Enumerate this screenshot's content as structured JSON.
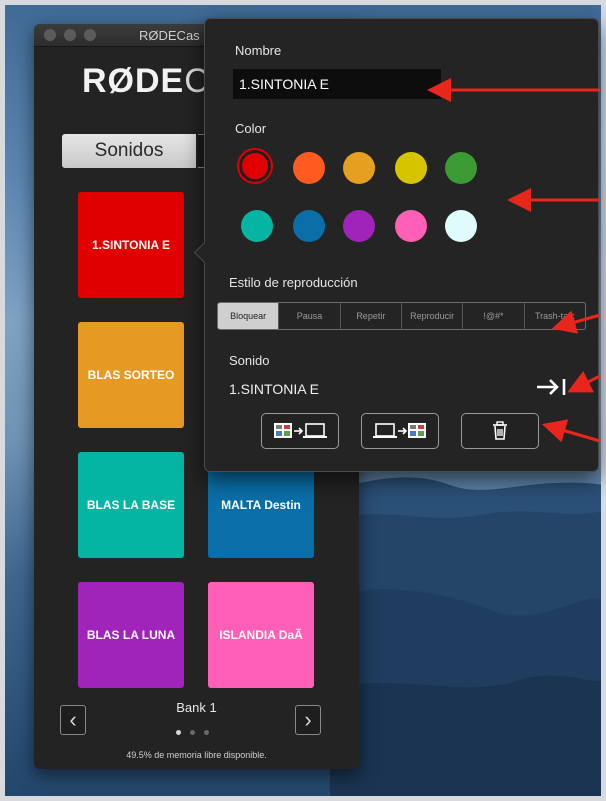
{
  "window": {
    "title": "RØDECas",
    "logo_bold": "RØDE",
    "logo_thin": "C"
  },
  "tabs": {
    "active": "Sonidos"
  },
  "pads": [
    {
      "label": "1.SINTONIA E",
      "color": "#e00000"
    },
    {
      "label": "BLAS SORTEO",
      "color": "#e69a22"
    },
    {
      "label": "BLAS LA BASE",
      "color": "#05b5a3"
    },
    {
      "label": "MALTA Destin",
      "color": "#0a6fa8"
    },
    {
      "label": "BLAS LA LUNA",
      "color": "#a024ba"
    },
    {
      "label": "ISLANDIA DaÃ",
      "color": "#ff5fb6"
    }
  ],
  "bank": {
    "label": "Bank 1",
    "prev_icon": "chevron-left-icon",
    "next_icon": "chevron-right-icon"
  },
  "memory_text": "49.5% de memoria libre disponible.",
  "popover": {
    "name_label": "Nombre",
    "name_value": "1.SINTONIA E",
    "color_label": "Color",
    "colors": [
      "#e00000",
      "#ff5a1f",
      "#e6a020",
      "#d6c400",
      "#3b9a33",
      "#05b5a3",
      "#0a6fa8",
      "#a024ba",
      "#ff5fb6",
      "#dffbfb"
    ],
    "selected_color": "#e00000",
    "playback_label": "Estilo de reproducción",
    "playback_modes": [
      "Bloquear",
      "Pausa",
      "Repetir",
      "Reproducir",
      "!@#*",
      "Trash-talk"
    ],
    "playback_active": "Bloquear",
    "sound_label": "Sonido",
    "sound_value": "1.SINTONIA E",
    "icons": [
      "load-sound-icon",
      "device-to-computer-icon",
      "computer-to-device-icon",
      "trash-icon"
    ]
  },
  "accent": "#e8261c"
}
